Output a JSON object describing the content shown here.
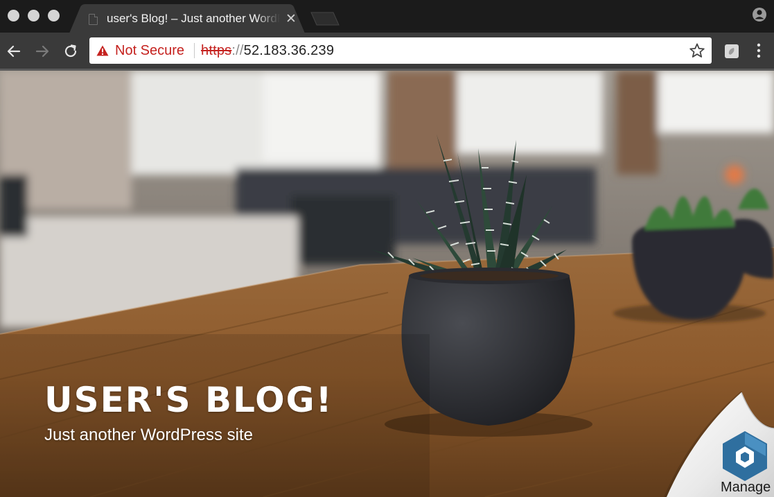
{
  "browser": {
    "tab": {
      "title": "user's Blog! – Just another WordPress site"
    },
    "address_bar": {
      "security_label": "Not Secure",
      "url_scheme": "https",
      "url_separator": "://",
      "url_host": "52.183.36.239"
    }
  },
  "site": {
    "title": "USER'S BLOG!",
    "tagline": "Just another WordPress site"
  },
  "manage_widget": {
    "label": "Manage"
  },
  "colors": {
    "warning": "#c5221f",
    "hex_logo": "#2f6f9f",
    "toolbar": "#3a3a3a",
    "tab_strip": "#1b1b1b"
  },
  "icons": [
    "page-icon",
    "close-icon",
    "back-arrow-icon",
    "forward-arrow-icon",
    "reload-icon",
    "warning-icon",
    "star-icon",
    "extension-icon",
    "menu-dots-icon",
    "profile-icon",
    "hexagon-logo-icon"
  ]
}
